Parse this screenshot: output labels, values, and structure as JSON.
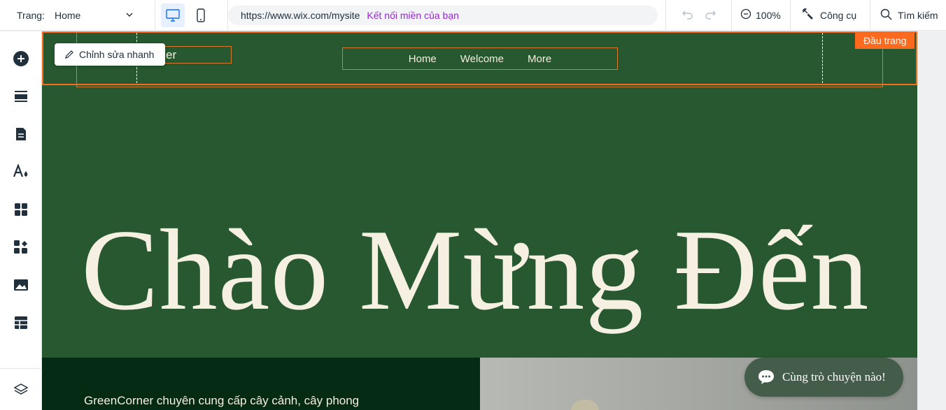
{
  "topbar": {
    "page_label": "Trang:",
    "page_value": "Home",
    "url": "https://www.wix.com/mysite",
    "connect_domain": "Kết nối miền của bạn",
    "zoom": "100%",
    "tools": "Công cụ",
    "search": "Tìm kiếm"
  },
  "sidebar": {
    "items": [
      "add-icon",
      "sections-icon",
      "pages-icon",
      "design-icon",
      "apps-icon",
      "app-market-icon",
      "media-icon",
      "cms-icon",
      "layers-icon"
    ]
  },
  "canvas": {
    "quick_edit": "Chỉnh sửa nhanh",
    "header_tag": "Đầu trang",
    "logo_text": "er",
    "nav": [
      "Home",
      "Welcome",
      "More"
    ],
    "hero_title": "Chào Mừng Đến",
    "band_text": "GreenCorner chuyên cung cấp cây cảnh, cây phong",
    "chat_label": "Cùng trò chuyện nào!"
  },
  "colors": {
    "canvas_bg": "#27582f",
    "selection": "#fb6a1e",
    "accent_blue": "#116dff",
    "connect_purple": "#9a27d5"
  }
}
